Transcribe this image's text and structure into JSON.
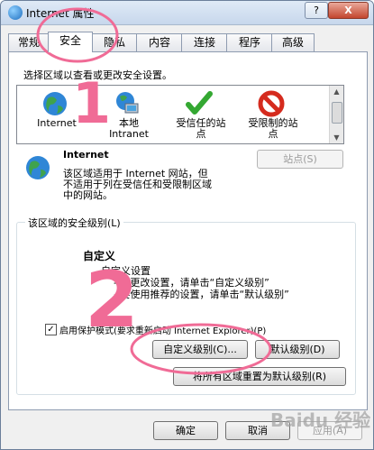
{
  "window": {
    "title": "Internet 属性",
    "help_label": "?",
    "close_label": "X"
  },
  "tabs": [
    {
      "label": "常规"
    },
    {
      "label": "安全",
      "active": true
    },
    {
      "label": "隐私"
    },
    {
      "label": "内容"
    },
    {
      "label": "连接"
    },
    {
      "label": "程序"
    },
    {
      "label": "高级"
    }
  ],
  "security": {
    "zone_prompt": "选择区域以查看或更改安全设置。",
    "zones": [
      {
        "line1": "Internet",
        "line2": "",
        "icon": "globe-icon"
      },
      {
        "line1": "本地",
        "line2": "Intranet",
        "icon": "local-intranet-icon"
      },
      {
        "line1": "受信任的站",
        "line2": "点",
        "icon": "checkmark-icon"
      },
      {
        "line1": "受限制的站",
        "line2": "点",
        "icon": "restricted-icon"
      }
    ],
    "selected_zone": {
      "name": "Internet",
      "desc1": "该区域适用于 Internet 网站，但",
      "desc2": "不适用于列在受信任和受限制区域",
      "desc3": "中的网站。"
    },
    "sites_button": "站点(S)",
    "level_group_label": "该区域的安全级别(L)",
    "custom_title": "自定义",
    "custom_line1": "自定义设置",
    "custom_line2": "- 要更改设置，请单击“自定义级别”",
    "custom_line3": "- 要使用推荐的设置，请单击“默认级别”",
    "protected_mode_label": "启用保护模式(要求重新启动 Internet Explorer)(P)",
    "protected_mode_checked": true,
    "custom_level_button": "自定义级别(C)...",
    "default_level_button": "默认级别(D)",
    "reset_all_button": "将所有区域重置为默认级别(R)"
  },
  "footer": {
    "ok": "确定",
    "cancel": "取消",
    "apply": "应用(A)"
  },
  "annotations": {
    "number1": "1",
    "number2": "2",
    "color": "#f06b96"
  },
  "watermark": "Baidu 经验"
}
